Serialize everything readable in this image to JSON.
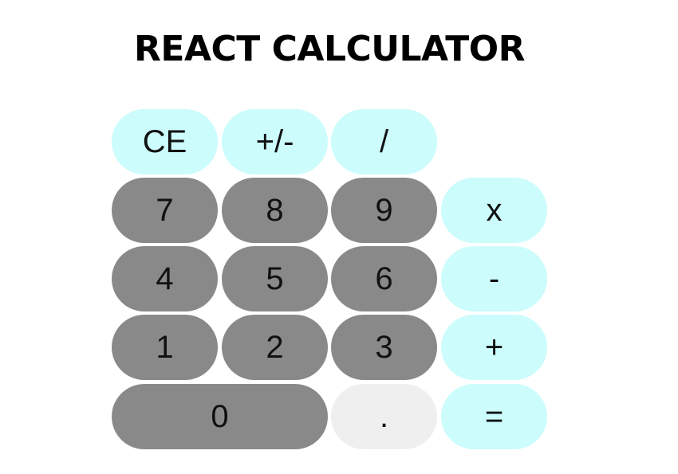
{
  "app": {
    "title": "REACT CALCULATOR"
  },
  "keys": {
    "clear": "CE",
    "negate": "+/-",
    "divide": "/",
    "multiply": "x",
    "subtract": "-",
    "add": "+",
    "equals": "=",
    "seven": "7",
    "eight": "8",
    "nine": "9",
    "four": "4",
    "five": "5",
    "six": "6",
    "one": "1",
    "two": "2",
    "three": "3",
    "zero": "0",
    "decimal": "."
  },
  "colors": {
    "operator": "#ccfcfc",
    "number": "#898989",
    "decimal": "#efefef"
  }
}
